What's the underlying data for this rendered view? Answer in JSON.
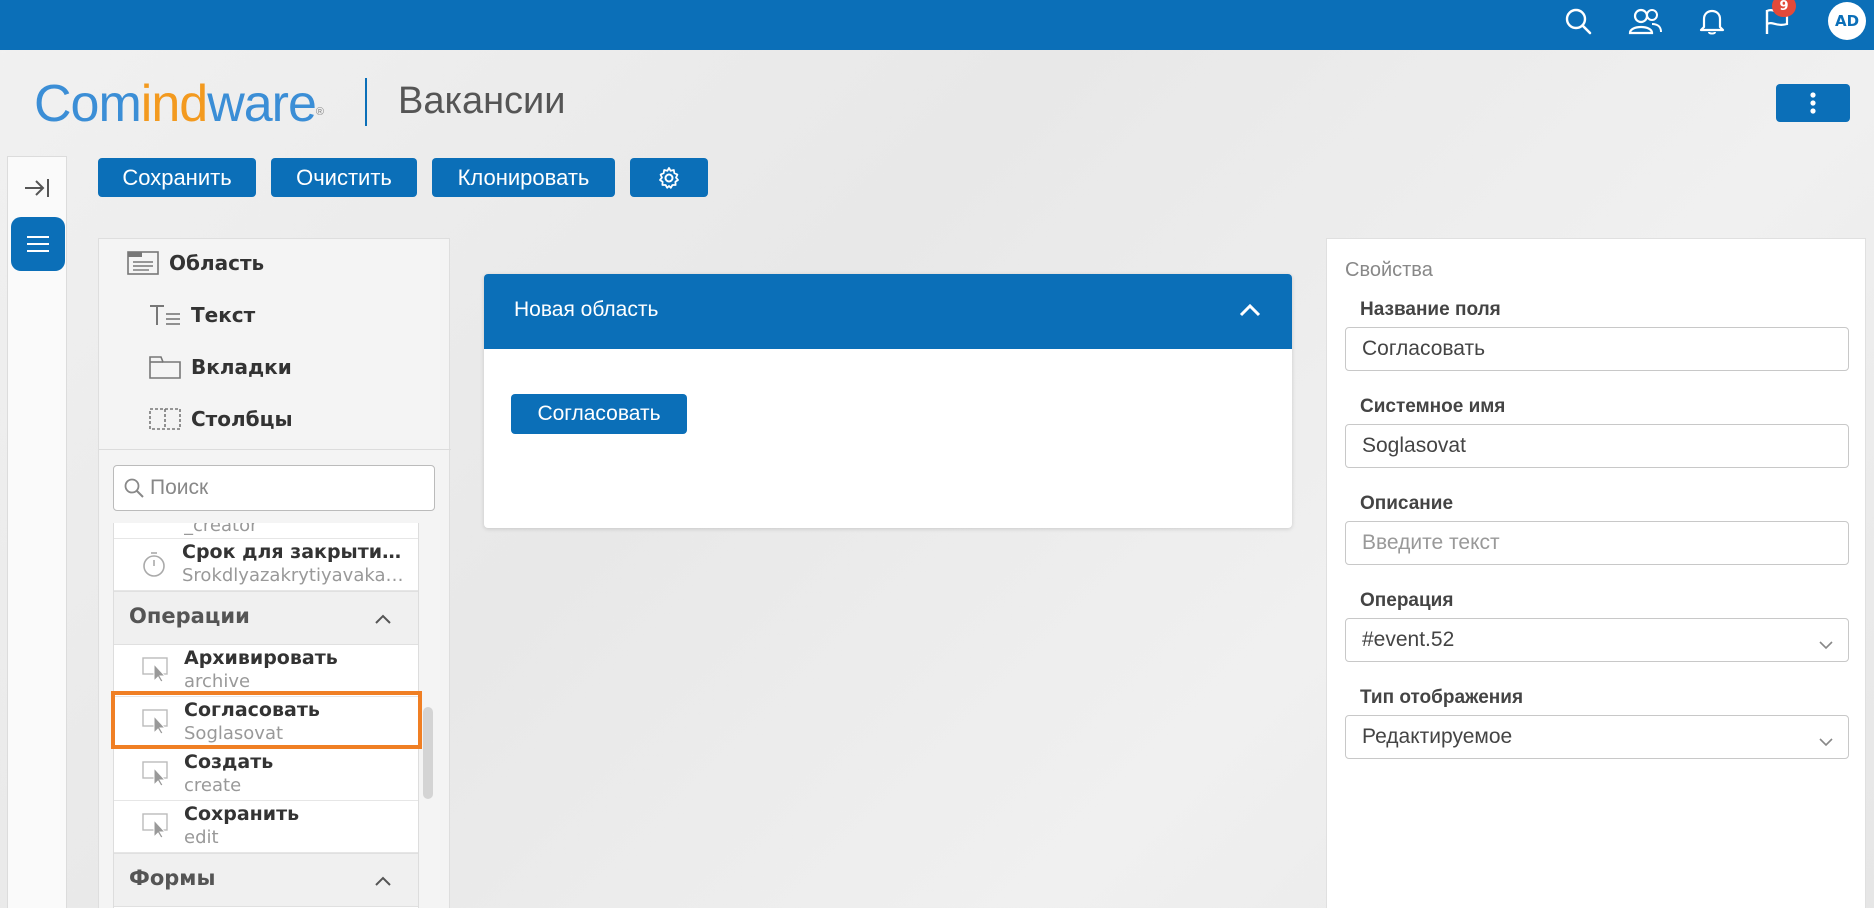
{
  "topbar": {
    "icons": [
      "search-icon",
      "users-icon",
      "bell-icon",
      "flag-icon"
    ],
    "notifications_count": "9",
    "avatar_initials": "AD",
    "bg_color": "#0b6fb8"
  },
  "header": {
    "logo_part1": "Com",
    "logo_part2": "ind",
    "logo_part3": "ware",
    "logo_mark": "®",
    "page_title": "Вакансии"
  },
  "toolbar": {
    "save_label": "Сохранить",
    "clear_label": "Очистить",
    "clone_label": "Клонировать",
    "settings_icon": "gear-icon"
  },
  "components": {
    "items": [
      {
        "label": "Область",
        "icon": "area-icon"
      },
      {
        "label": "Текст",
        "icon": "text-icon"
      },
      {
        "label": "Вкладки",
        "icon": "tabs-icon"
      },
      {
        "label": "Столбцы",
        "icon": "columns-icon"
      }
    ],
    "search_placeholder": "Поиск",
    "list": {
      "partial_item_sub": "_creator",
      "deadline_item": {
        "title": "Срок для закрытия вакансии",
        "sub": "Srokdlyazakrytiyavakansii"
      },
      "operations_group": "Операции",
      "operations": [
        {
          "title": "Архивировать",
          "sub": "archive"
        },
        {
          "title": "Согласовать",
          "sub": "Soglasovat"
        },
        {
          "title": "Создать",
          "sub": "create"
        },
        {
          "title": "Сохранить",
          "sub": "edit"
        }
      ],
      "forms_group": "Формы"
    }
  },
  "canvas": {
    "area_title": "Новая область",
    "action_button": "Согласовать"
  },
  "properties": {
    "title": "Свойства",
    "field_name_label": "Название поля",
    "field_name_value": "Согласовать",
    "system_name_label": "Системное имя",
    "system_name_value": "Soglasovat",
    "description_label": "Описание",
    "description_placeholder": "Введите текст",
    "operation_label": "Операция",
    "operation_value": "#event.52",
    "display_type_label": "Тип отображения",
    "display_type_value": "Редактируемое"
  },
  "colors": {
    "accent": "#0b6fb8",
    "highlight": "#f07f24",
    "logo_blue": "#3b8ed6",
    "logo_orange": "#f39a1f"
  }
}
